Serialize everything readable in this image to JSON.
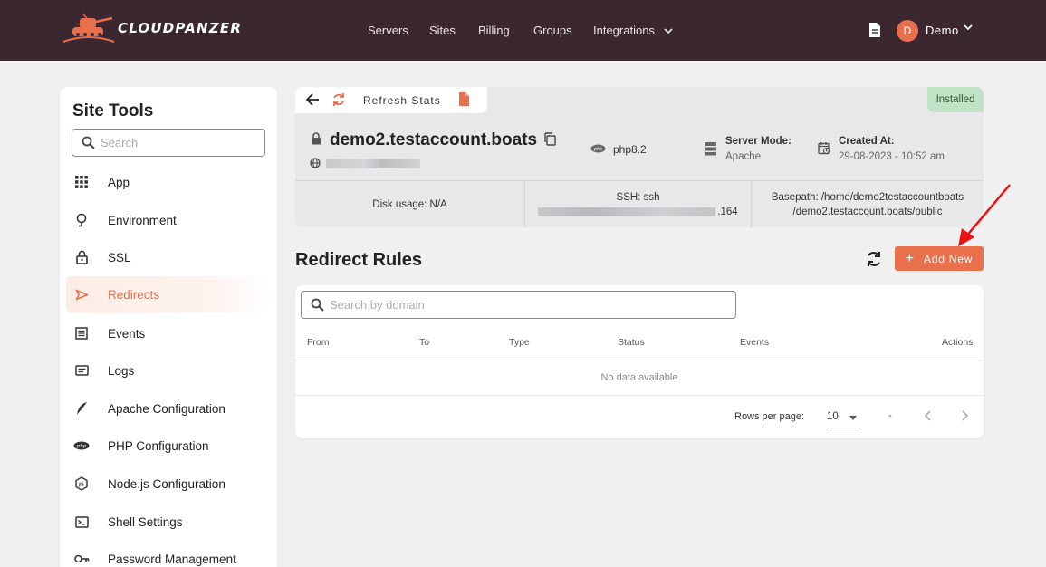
{
  "brand": {
    "name": "CLOUDPANZER"
  },
  "nav": {
    "items": [
      "Servers",
      "Sites",
      "Billing",
      "Groups",
      "Integrations"
    ],
    "user_initial": "D",
    "user_name": "Demo"
  },
  "sidebar": {
    "title": "Site Tools",
    "search_placeholder": "Search",
    "items": [
      {
        "label": "App",
        "icon": "grid-icon"
      },
      {
        "label": "Environment",
        "icon": "environment-icon"
      },
      {
        "label": "SSL",
        "icon": "lock-icon"
      },
      {
        "label": "Redirects",
        "icon": "redirect-icon",
        "active": true
      },
      {
        "label": "Events",
        "icon": "events-icon"
      },
      {
        "label": "Logs",
        "icon": "logs-icon"
      },
      {
        "label": "Apache Configuration",
        "icon": "feather-icon"
      },
      {
        "label": "PHP Configuration",
        "icon": "php-icon"
      },
      {
        "label": "Node.js Configuration",
        "icon": "nodejs-icon"
      },
      {
        "label": "Shell Settings",
        "icon": "terminal-icon"
      },
      {
        "label": "Password Management",
        "icon": "key-icon"
      }
    ]
  },
  "site": {
    "refresh_label": "Refresh Stats",
    "status": "Installed",
    "domain": "demo2.testaccount.boats",
    "php_version": "php8.2",
    "server_mode_label": "Server Mode:",
    "server_mode": "Apache",
    "created_label": "Created At:",
    "created_at": "29-08-2023 - 10:52 am",
    "disk_usage": "Disk usage: N/A",
    "ssh_label": "SSH: ssh",
    "ssh_tail": ".164",
    "basepath_label": "Basepath:",
    "basepath_line1": "/home/demo2testaccountboats",
    "basepath_line2": "/demo2.testaccount.boats/public"
  },
  "redirects": {
    "title": "Redirect Rules",
    "add_label": "Add New",
    "search_placeholder": "Search by domain",
    "columns": [
      "From",
      "To",
      "Type",
      "Status",
      "Events",
      "Actions"
    ],
    "empty_text": "No data available",
    "rows_per_page_label": "Rows per page:",
    "rows_per_page": "10",
    "range": "-"
  },
  "colors": {
    "accent": "#e8704d",
    "topbar": "#3a2730",
    "installed": "#bfe3c4"
  }
}
